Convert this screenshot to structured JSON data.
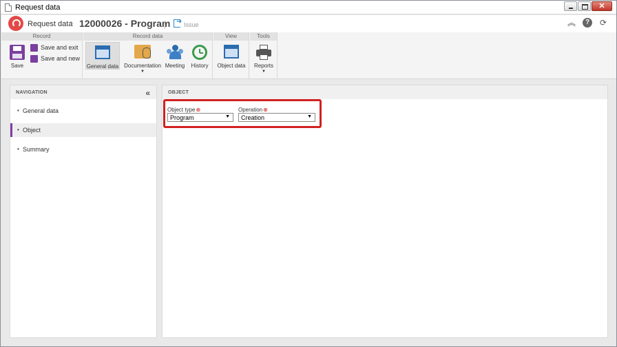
{
  "window": {
    "title": "Request data"
  },
  "header": {
    "breadcrumb_parent": "Request data",
    "breadcrumb_sep": "›",
    "record_title": "12000026 - Program",
    "issue_label": "Issue",
    "icons": [
      "collapse-up-icon",
      "help-icon",
      "refresh-icon"
    ]
  },
  "ribbon": {
    "groups": {
      "record": "Record",
      "record_data": "Record data",
      "view": "View",
      "tools": "Tools"
    },
    "buttons": {
      "save": "Save",
      "save_exit": "Save and exit",
      "save_new": "Save and new",
      "general_data": "General data",
      "documentation": "Documentation",
      "meeting": "Meeting",
      "history": "History",
      "object_data": "Object data",
      "reports": "Reports"
    }
  },
  "navigation": {
    "title": "NAVIGATION",
    "items": [
      {
        "label": "General data",
        "active": false
      },
      {
        "label": "Object",
        "active": true
      },
      {
        "label": "Summary",
        "active": false
      }
    ]
  },
  "object_panel": {
    "title": "OBJECT",
    "object_type": {
      "label": "Object type",
      "value": "Program"
    },
    "operation": {
      "label": "Operation",
      "value": "Creation"
    }
  },
  "colors": {
    "accent": "#7b3fa0",
    "highlight": "#d12020",
    "required": "#d81c1c"
  }
}
